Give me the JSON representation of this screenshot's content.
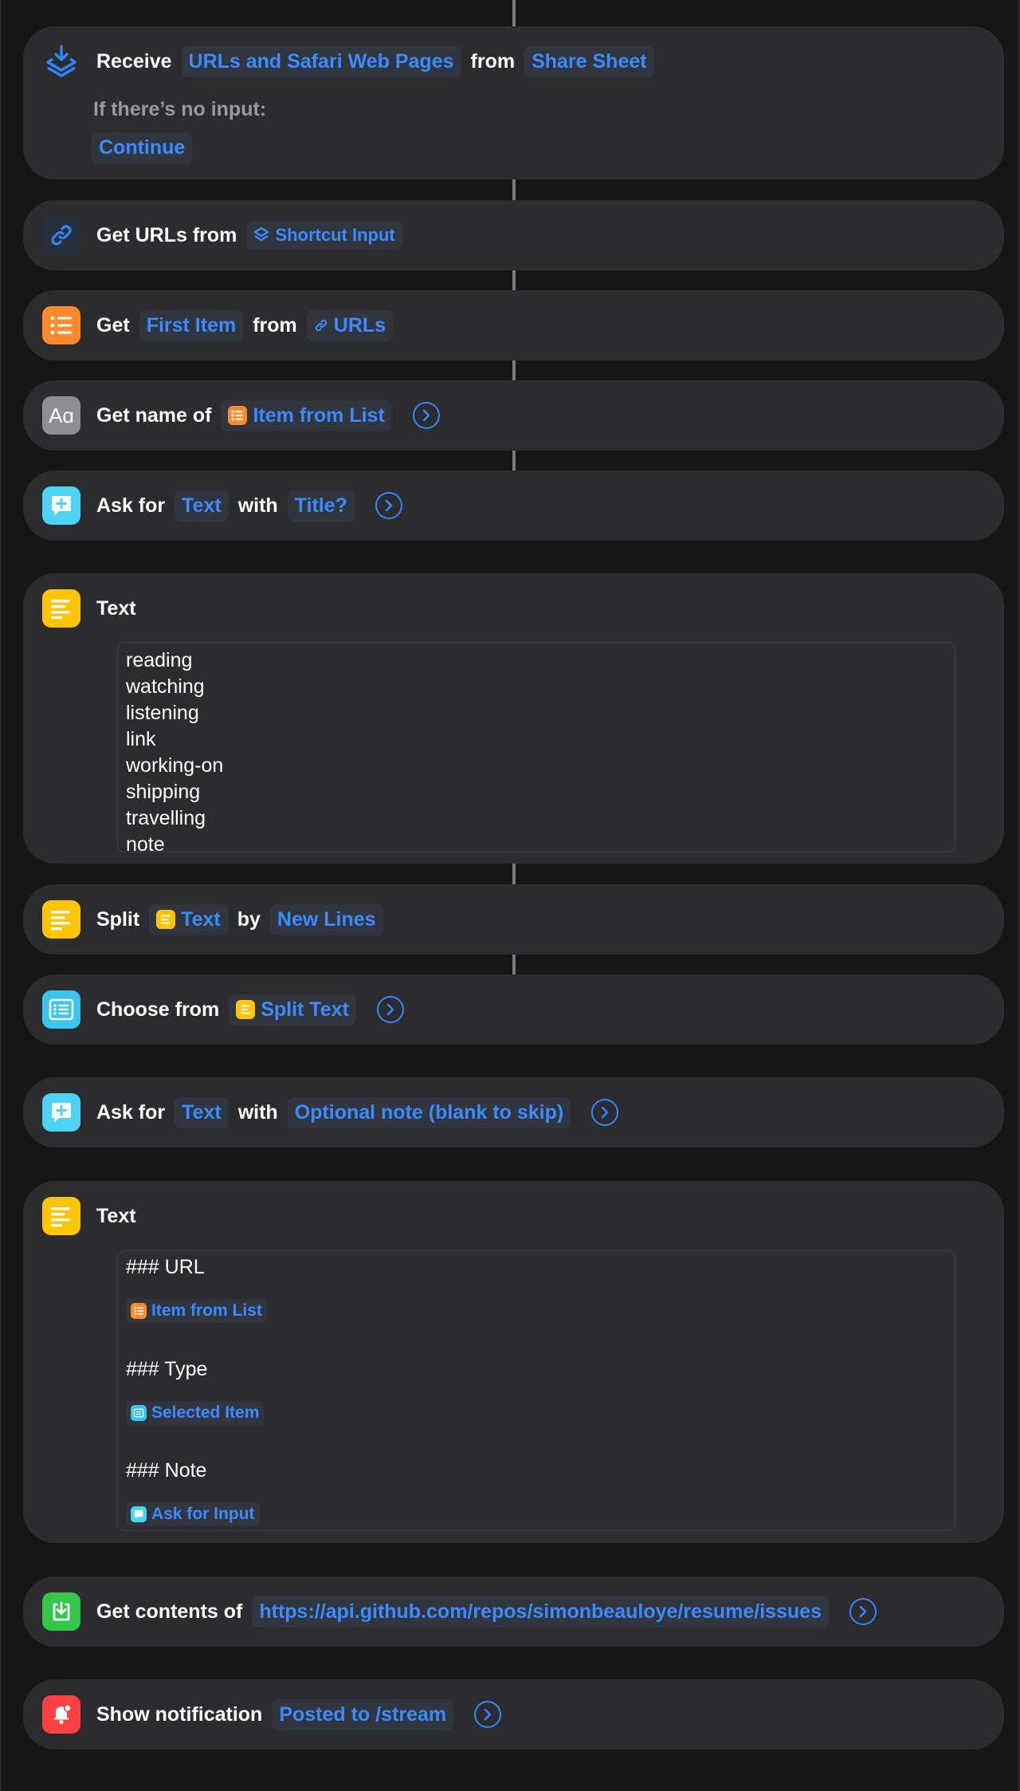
{
  "actions": {
    "receive": {
      "label_receive": "Receive",
      "types": "URLs and Safari Web Pages",
      "label_from": "from",
      "source": "Share Sheet",
      "no_input_label": "If there’s no input:",
      "no_input_value": "Continue"
    },
    "get_urls": {
      "label": "Get URLs from",
      "source": "Shortcut Input"
    },
    "get_item": {
      "label_get": "Get",
      "which": "First Item",
      "label_from": "from",
      "source": "URLs"
    },
    "get_name": {
      "label": "Get name of",
      "source": "Item from List"
    },
    "ask_title": {
      "label_ask": "Ask for",
      "type": "Text",
      "label_with": "with",
      "prompt": "Title?"
    },
    "text_types": {
      "title": "Text",
      "lines": [
        "reading",
        "watching",
        "listening",
        "link",
        "working-on",
        "shipping",
        "travelling",
        "note"
      ]
    },
    "split": {
      "label_split": "Split",
      "source": "Text",
      "label_by": "by",
      "separator": "New Lines"
    },
    "choose": {
      "label": "Choose from",
      "source": "Split Text"
    },
    "ask_note": {
      "label_ask": "Ask for",
      "type": "Text",
      "label_with": "with",
      "prompt": "Optional note (blank to skip)"
    },
    "text_body": {
      "title": "Text",
      "heading_url": "### URL",
      "var_url": "Item from List",
      "heading_type": "### Type",
      "var_type": "Selected Item",
      "heading_note": "### Note",
      "var_note": "Ask for Input"
    },
    "get_contents": {
      "label": "Get contents of",
      "url": "https://api.github.com/repos/simonbeauloye/resume/issues"
    },
    "notify": {
      "label": "Show notification",
      "message": "Posted to /stream"
    }
  },
  "icons": {
    "receive": "share-sheet-receive-icon",
    "get_urls": "link-icon",
    "list": "list-icon",
    "text_name": "text-aa-icon",
    "ask": "ask-input-icon",
    "text": "text-lines-icon",
    "choose": "choose-list-icon",
    "get_contents": "download-icon",
    "notify": "bell-icon",
    "chevron": "chevron-right-icon"
  },
  "colors": {
    "background": "#161616",
    "card": "#2c2c2e",
    "token_text": "#3b8bff",
    "token_bg": "#31353d",
    "list_orange": "#ff8a2e",
    "ask_cyan": "#4ad3f5",
    "text_yellow": "#ffc500",
    "choose_cyan": "#38c6ef",
    "green": "#33c749",
    "red": "#ff4141"
  }
}
